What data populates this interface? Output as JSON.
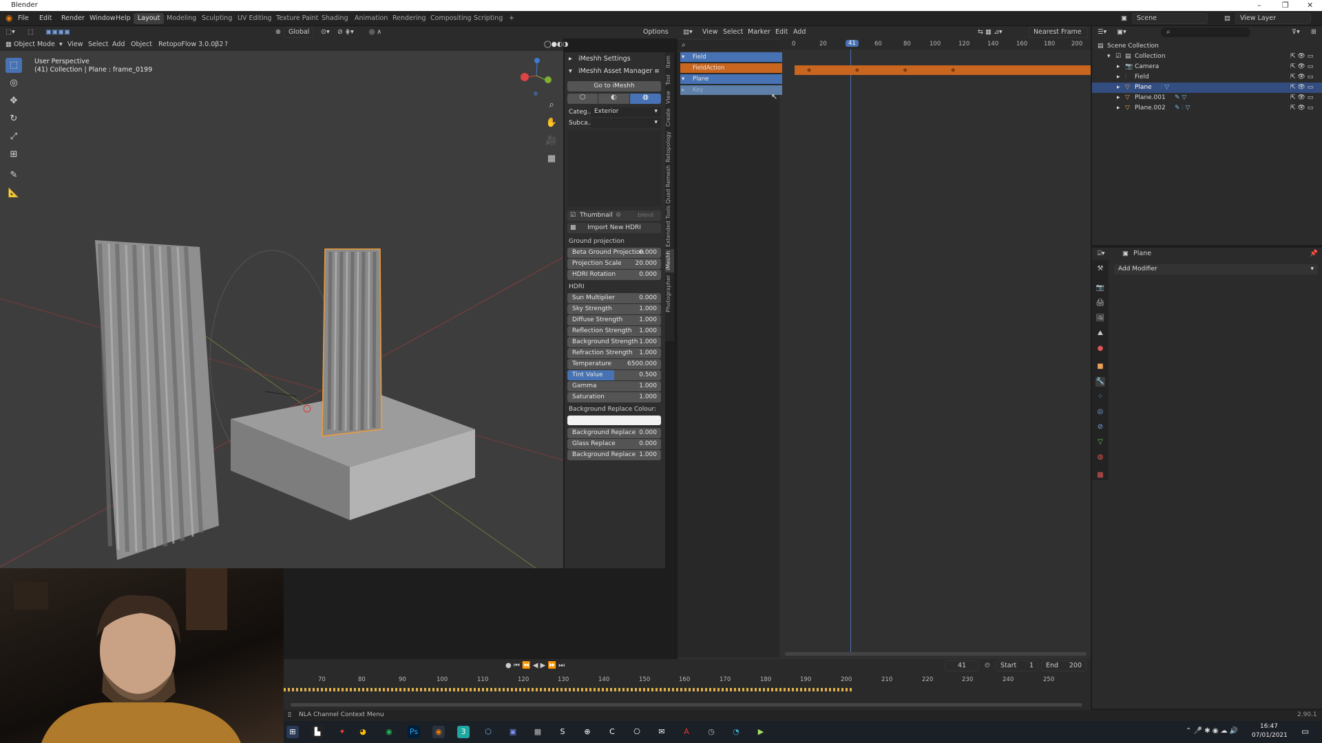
{
  "titlebar": {
    "title": "Blender"
  },
  "menubar": {
    "menus": [
      "File",
      "Edit",
      "Render",
      "Window",
      "Help"
    ],
    "workspaces": [
      "Layout",
      "Modeling",
      "Sculpting",
      "UV Editing",
      "Texture Paint",
      "Shading",
      "Animation",
      "Rendering",
      "Compositing",
      "Scripting"
    ],
    "active_workspace": "Layout",
    "scene_label": "Scene",
    "view_layer_label": "View Layer"
  },
  "viewport": {
    "mode": "Object Mode",
    "menus": [
      "View",
      "Select",
      "Add",
      "Object"
    ],
    "addon": "RetopoFlow 3.0.0β2",
    "orientation": "Global",
    "options_label": "Options",
    "overlay_title": "User Perspective",
    "overlay_subtitle": "(41) Collection | Plane : frame_0199"
  },
  "imeshh": {
    "settings_title": "iMeshh Settings",
    "asset_manager_title": "iMeshh Asset Manager",
    "go_button": "Go to iMeshh",
    "category_label": "Categ...",
    "category_value": "Exterior",
    "subcategory_label": "Subca...",
    "subcategory_value": "",
    "thumbnail_label": "Thumbnail",
    "thumbnail_hint": ".blend",
    "import_hdri_button": "Import New HDRI",
    "ground_projection_label": "Ground projection",
    "ground_fields": [
      {
        "label": "Beta Ground Projection",
        "value": "0.000"
      },
      {
        "label": "Projection Scale",
        "value": "20.000"
      },
      {
        "label": "HDRI Rotation",
        "value": "0.000"
      }
    ],
    "hdri_label": "HDRI",
    "hdri_fields": [
      {
        "label": "Sun Multiplier",
        "value": "0.000"
      },
      {
        "label": "Sky Strength",
        "value": "1.000"
      },
      {
        "label": "Diffuse Strength",
        "value": "1.000"
      },
      {
        "label": "Reflection Strength",
        "value": "1.000"
      },
      {
        "label": "Background Strength",
        "value": "1.000"
      },
      {
        "label": "Refraction Strength",
        "value": "1.000"
      },
      {
        "label": "Temperature",
        "value": "6500.000"
      },
      {
        "label": "Tint Value",
        "value": "0.500"
      },
      {
        "label": "Gamma",
        "value": "1.000"
      },
      {
        "label": "Saturation",
        "value": "1.000"
      }
    ],
    "bg_replace_colour_label": "Background Replace Colour:",
    "replace_fields": [
      {
        "label": "Background Replace",
        "value": "0.000"
      },
      {
        "label": "Glass Replace",
        "value": "0.000"
      },
      {
        "label": "Background Replace",
        "value": "1.000"
      }
    ],
    "tint_fill_fraction": 0.5
  },
  "vertical_tabs": [
    "Item",
    "Tool",
    "View",
    "Create",
    "Retopology",
    "Quad Remesh",
    "Extended Tools",
    "iMeshh",
    "Photographer"
  ],
  "nla": {
    "menus": [
      "View",
      "Select",
      "Marker",
      "Edit",
      "Add"
    ],
    "snap": "Nearest Frame",
    "ruler_ticks": [
      "0",
      "20",
      "40",
      "60",
      "80",
      "100",
      "120",
      "140",
      "160",
      "180",
      "200"
    ],
    "current_frame": "41",
    "channels": [
      {
        "label": "Field",
        "kind": "object"
      },
      {
        "label": "FieldAction",
        "kind": "action"
      },
      {
        "label": "Plane",
        "kind": "object"
      },
      {
        "label": "Key",
        "kind": "key"
      }
    ]
  },
  "timeline": {
    "ticks": [
      "70",
      "80",
      "90",
      "100",
      "110",
      "120",
      "130",
      "140",
      "150",
      "160",
      "170",
      "180",
      "190",
      "200",
      "210",
      "220",
      "230",
      "240",
      "250"
    ],
    "current_frame": "41",
    "start_label": "Start",
    "start_value": "1",
    "end_label": "End",
    "end_value": "200"
  },
  "outliner": {
    "root": "Scene Collection",
    "items": [
      {
        "label": "Collection",
        "indent": 1
      },
      {
        "label": "Camera",
        "indent": 2
      },
      {
        "label": "Field",
        "indent": 2
      },
      {
        "label": "Plane",
        "indent": 2,
        "selected": true
      },
      {
        "label": "Plane.001",
        "indent": 2
      },
      {
        "label": "Plane.002",
        "indent": 2
      }
    ]
  },
  "properties": {
    "object_name": "Plane",
    "add_modifier": "Add Modifier"
  },
  "statusbar": {
    "left": "NLA Channel Context Menu",
    "version": "2.90.1"
  },
  "taskbar": {
    "time": "16:47",
    "date": "07/01/2021"
  },
  "colors": {
    "accent": "#4772b3",
    "selected_object": "#f29d39",
    "action_strip": "#c8651f"
  }
}
